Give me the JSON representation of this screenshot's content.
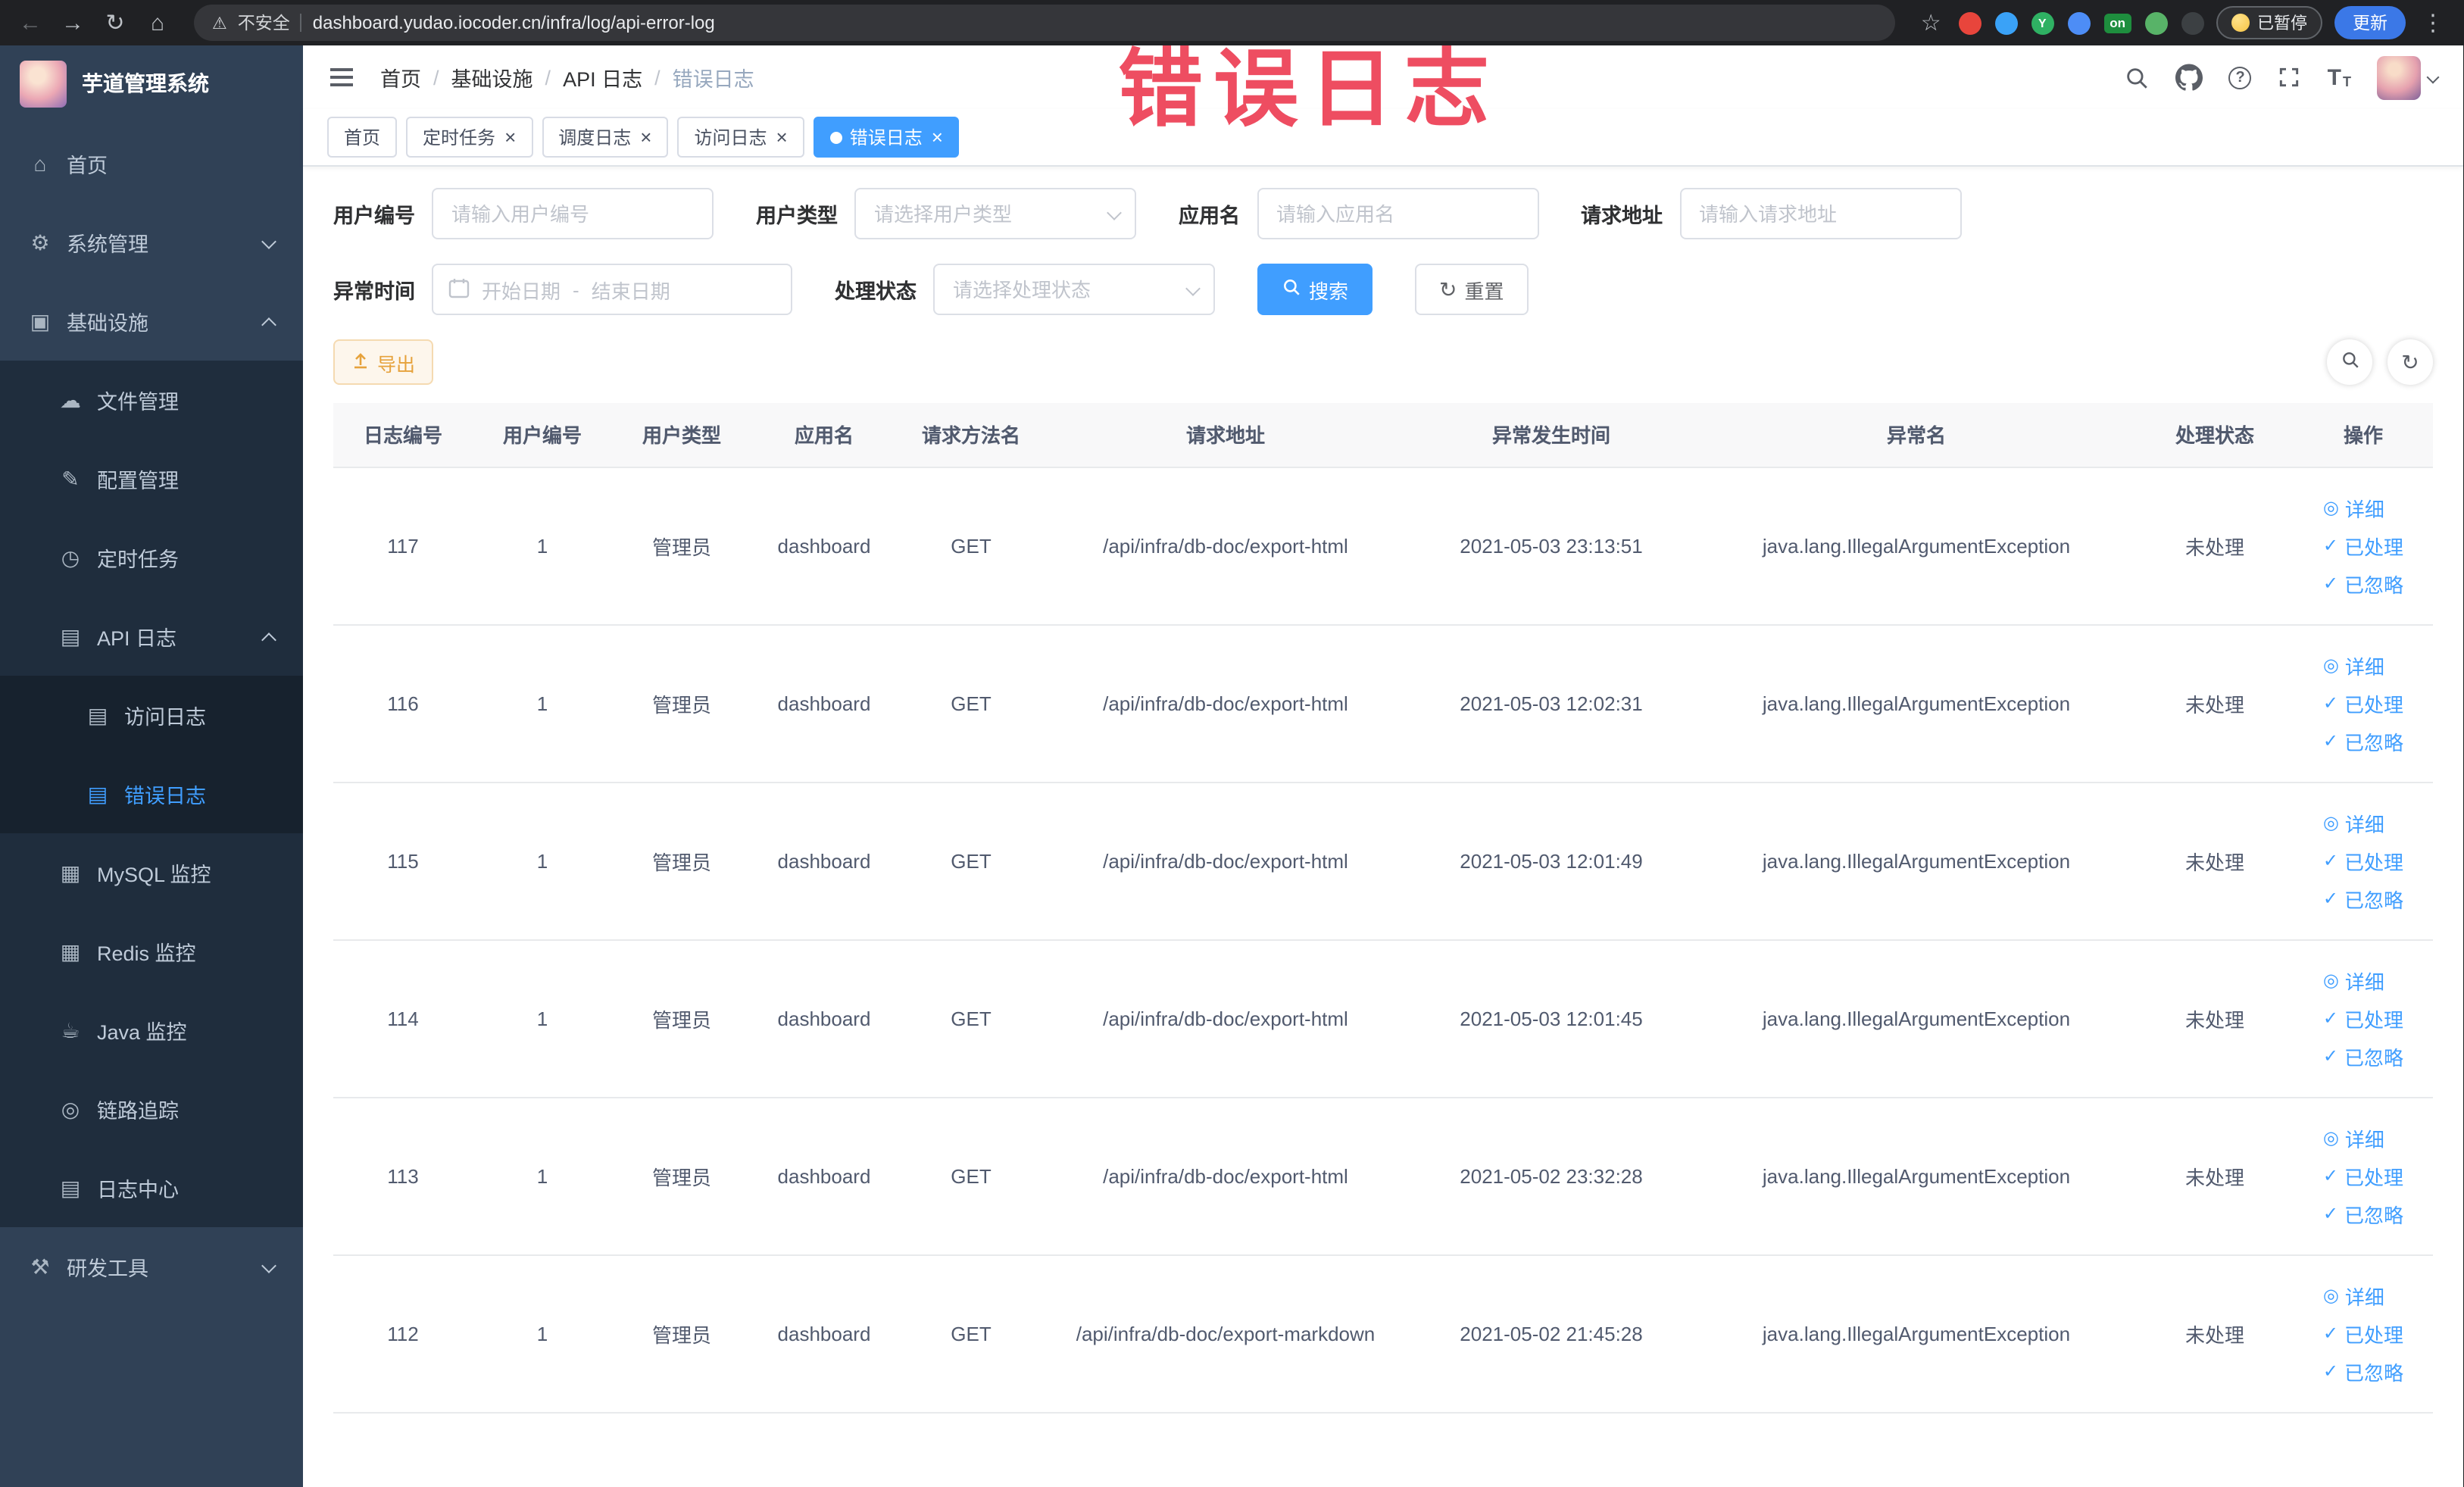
{
  "browser": {
    "security_label": "不安全",
    "url": "dashboard.yudao.iocoder.cn/infra/log/api-error-log",
    "extensions": [
      {
        "name": "extension-red",
        "color": "#e8453c"
      },
      {
        "name": "extension-blue",
        "color": "#3aa2f7"
      },
      {
        "name": "extension-green-y",
        "color": "#2fb163",
        "letter": "Y"
      },
      {
        "name": "extension-grid",
        "color": "#4d8df6"
      },
      {
        "name": "extension-on-badge",
        "color": "#1e8e3e",
        "label": "on"
      },
      {
        "name": "extension-sprout",
        "color": "#58b368"
      },
      {
        "name": "extension-dark",
        "color": "#3c4043"
      }
    ],
    "paused_badge": "已暂停",
    "update_button": "更新"
  },
  "annotation": "错误日志",
  "sidebar": {
    "title": "芋道管理系统",
    "items": [
      {
        "name": "home",
        "label": "首页",
        "icon": "home-icon",
        "glyph": "⌂",
        "depth": 0
      },
      {
        "name": "system",
        "label": "系统管理",
        "icon": "gear-icon",
        "glyph": "⚙",
        "depth": 0,
        "chevron": "down"
      },
      {
        "name": "infra",
        "label": "基础设施",
        "icon": "infra-icon",
        "glyph": "▣",
        "depth": 0,
        "chevron": "up"
      },
      {
        "name": "file-manage",
        "label": "文件管理",
        "icon": "cloud-icon",
        "glyph": "☁",
        "depth": 1
      },
      {
        "name": "config-manage",
        "label": "配置管理",
        "icon": "edit-icon",
        "glyph": "✎",
        "depth": 1
      },
      {
        "name": "scheduled-job",
        "label": "定时任务",
        "icon": "timer-icon",
        "glyph": "◷",
        "depth": 1
      },
      {
        "name": "api-log",
        "label": "API 日志",
        "icon": "log-icon",
        "glyph": "▤",
        "depth": 1,
        "chevron": "up"
      },
      {
        "name": "access-log",
        "label": "访问日志",
        "icon": "doc-icon",
        "glyph": "▤",
        "depth": 2
      },
      {
        "name": "error-log",
        "label": "错误日志",
        "icon": "doc-icon",
        "glyph": "▤",
        "depth": 2,
        "active": true
      },
      {
        "name": "mysql-monitor",
        "label": "MySQL 监控",
        "icon": "database-icon",
        "glyph": "▦",
        "depth": 1
      },
      {
        "name": "redis-monitor",
        "label": "Redis 监控",
        "icon": "database-icon",
        "glyph": "▦",
        "depth": 1
      },
      {
        "name": "java-monitor",
        "label": "Java 监控",
        "icon": "coffee-icon",
        "glyph": "☕",
        "depth": 1
      },
      {
        "name": "trace",
        "label": "链路追踪",
        "icon": "trace-icon",
        "glyph": "◎",
        "depth": 1
      },
      {
        "name": "log-center",
        "label": "日志中心",
        "icon": "doc-icon",
        "glyph": "▤",
        "depth": 1
      },
      {
        "name": "dev-tools",
        "label": "研发工具",
        "icon": "tools-icon",
        "glyph": "⚒",
        "depth": 0,
        "chevron": "down"
      }
    ]
  },
  "header": {
    "breadcrumb": [
      "首页",
      "基础设施",
      "API 日志",
      "错误日志"
    ]
  },
  "tabs": [
    {
      "name": "home",
      "label": "首页",
      "closable": false,
      "active": false
    },
    {
      "name": "scheduled-job",
      "label": "定时任务",
      "closable": true,
      "active": false
    },
    {
      "name": "schedule-log",
      "label": "调度日志",
      "closable": true,
      "active": false
    },
    {
      "name": "access-log",
      "label": "访问日志",
      "closable": true,
      "active": false
    },
    {
      "name": "error-log",
      "label": "错误日志",
      "closable": true,
      "active": true
    }
  ],
  "filters": {
    "user_id": {
      "label": "用户编号",
      "placeholder": "请输入用户编号"
    },
    "user_type": {
      "label": "用户类型",
      "placeholder": "请选择用户类型"
    },
    "app_name": {
      "label": "应用名",
      "placeholder": "请输入应用名"
    },
    "request_url": {
      "label": "请求地址",
      "placeholder": "请输入请求地址"
    },
    "exception_time": {
      "label": "异常时间",
      "start_placeholder": "开始日期",
      "separator": "-",
      "end_placeholder": "结束日期"
    },
    "process_status": {
      "label": "处理状态",
      "placeholder": "请选择处理状态"
    },
    "search_label": "搜索",
    "reset_label": "重置"
  },
  "toolbar": {
    "export_label": "导出"
  },
  "table": {
    "headers": [
      "日志编号",
      "用户编号",
      "用户类型",
      "应用名",
      "请求方法名",
      "请求地址",
      "异常发生时间",
      "异常名",
      "处理状态",
      "操作"
    ],
    "actions": {
      "detail": "详细",
      "processed": "已处理",
      "ignored": "已忽略"
    },
    "rows": [
      {
        "id": "117",
        "user_id": "1",
        "user_type": "管理员",
        "app": "dashboard",
        "method": "GET",
        "url": "/api/infra/db-doc/export-html",
        "time": "2021-05-03 23:13:51",
        "exception": "java.lang.IllegalArgumentException",
        "status": "未处理"
      },
      {
        "id": "116",
        "user_id": "1",
        "user_type": "管理员",
        "app": "dashboard",
        "method": "GET",
        "url": "/api/infra/db-doc/export-html",
        "time": "2021-05-03 12:02:31",
        "exception": "java.lang.IllegalArgumentException",
        "status": "未处理"
      },
      {
        "id": "115",
        "user_id": "1",
        "user_type": "管理员",
        "app": "dashboard",
        "method": "GET",
        "url": "/api/infra/db-doc/export-html",
        "time": "2021-05-03 12:01:49",
        "exception": "java.lang.IllegalArgumentException",
        "status": "未处理"
      },
      {
        "id": "114",
        "user_id": "1",
        "user_type": "管理员",
        "app": "dashboard",
        "method": "GET",
        "url": "/api/infra/db-doc/export-html",
        "time": "2021-05-03 12:01:45",
        "exception": "java.lang.IllegalArgumentException",
        "status": "未处理"
      },
      {
        "id": "113",
        "user_id": "1",
        "user_type": "管理员",
        "app": "dashboard",
        "method": "GET",
        "url": "/api/infra/db-doc/export-html",
        "time": "2021-05-02 23:32:28",
        "exception": "java.lang.IllegalArgumentException",
        "status": "未处理"
      },
      {
        "id": "112",
        "user_id": "1",
        "user_type": "管理员",
        "app": "dashboard",
        "method": "GET",
        "url": "/api/infra/db-doc/export-markdown",
        "time": "2021-05-02 21:45:28",
        "exception": "java.lang.IllegalArgumentException",
        "status": "未处理"
      }
    ]
  }
}
